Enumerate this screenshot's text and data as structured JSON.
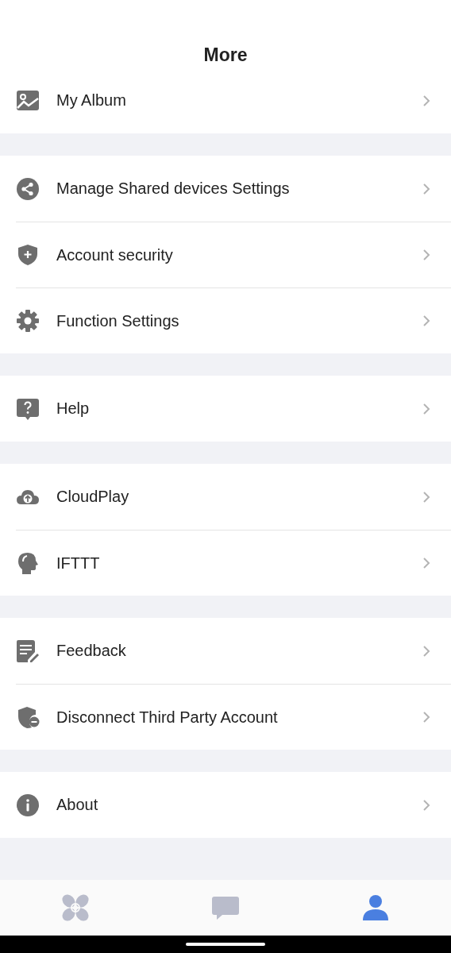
{
  "title": "More",
  "groups": [
    {
      "items": [
        {
          "kind": "album",
          "label": "My Album"
        }
      ]
    },
    {
      "items": [
        {
          "kind": "share",
          "label": "Manage Shared devices Settings"
        },
        {
          "kind": "shield",
          "label": "Account security"
        },
        {
          "kind": "gear",
          "label": "Function Settings"
        }
      ]
    },
    {
      "items": [
        {
          "kind": "help",
          "label": "Help"
        }
      ]
    },
    {
      "items": [
        {
          "kind": "cloud",
          "label": "CloudPlay"
        },
        {
          "kind": "head",
          "label": "IFTTT"
        }
      ]
    },
    {
      "items": [
        {
          "kind": "feedback",
          "label": "Feedback"
        },
        {
          "kind": "unlink",
          "label": "Disconnect Third Party Account"
        }
      ]
    },
    {
      "items": [
        {
          "kind": "info",
          "label": "About"
        }
      ]
    }
  ],
  "tabs": [
    {
      "kind": "fan",
      "selected": false
    },
    {
      "kind": "chat",
      "selected": false
    },
    {
      "kind": "person",
      "selected": true
    }
  ]
}
